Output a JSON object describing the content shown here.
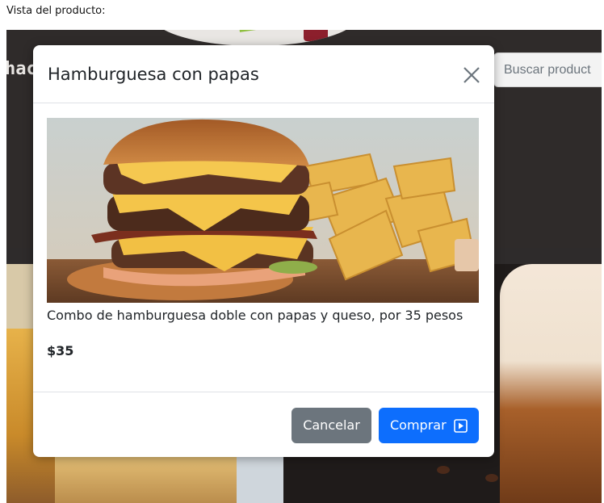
{
  "caption": "Vista del producto:",
  "background": {
    "brand_fragment": "hac",
    "search_placeholder": "Buscar product"
  },
  "modal": {
    "title": "Hamburguesa con papas",
    "close_icon": "close-icon",
    "image_icon": "burger-with-fries-photo",
    "description": "Combo de hamburguesa doble con papas y queso, por 35 pesos",
    "price": "$35",
    "cancel_label": "Cancelar",
    "buy_label": "Comprar",
    "buy_icon": "play-square-icon"
  },
  "colors": {
    "primary": "#0d6efd",
    "secondary": "#6c757d",
    "backdrop": "#2f2b2a"
  }
}
